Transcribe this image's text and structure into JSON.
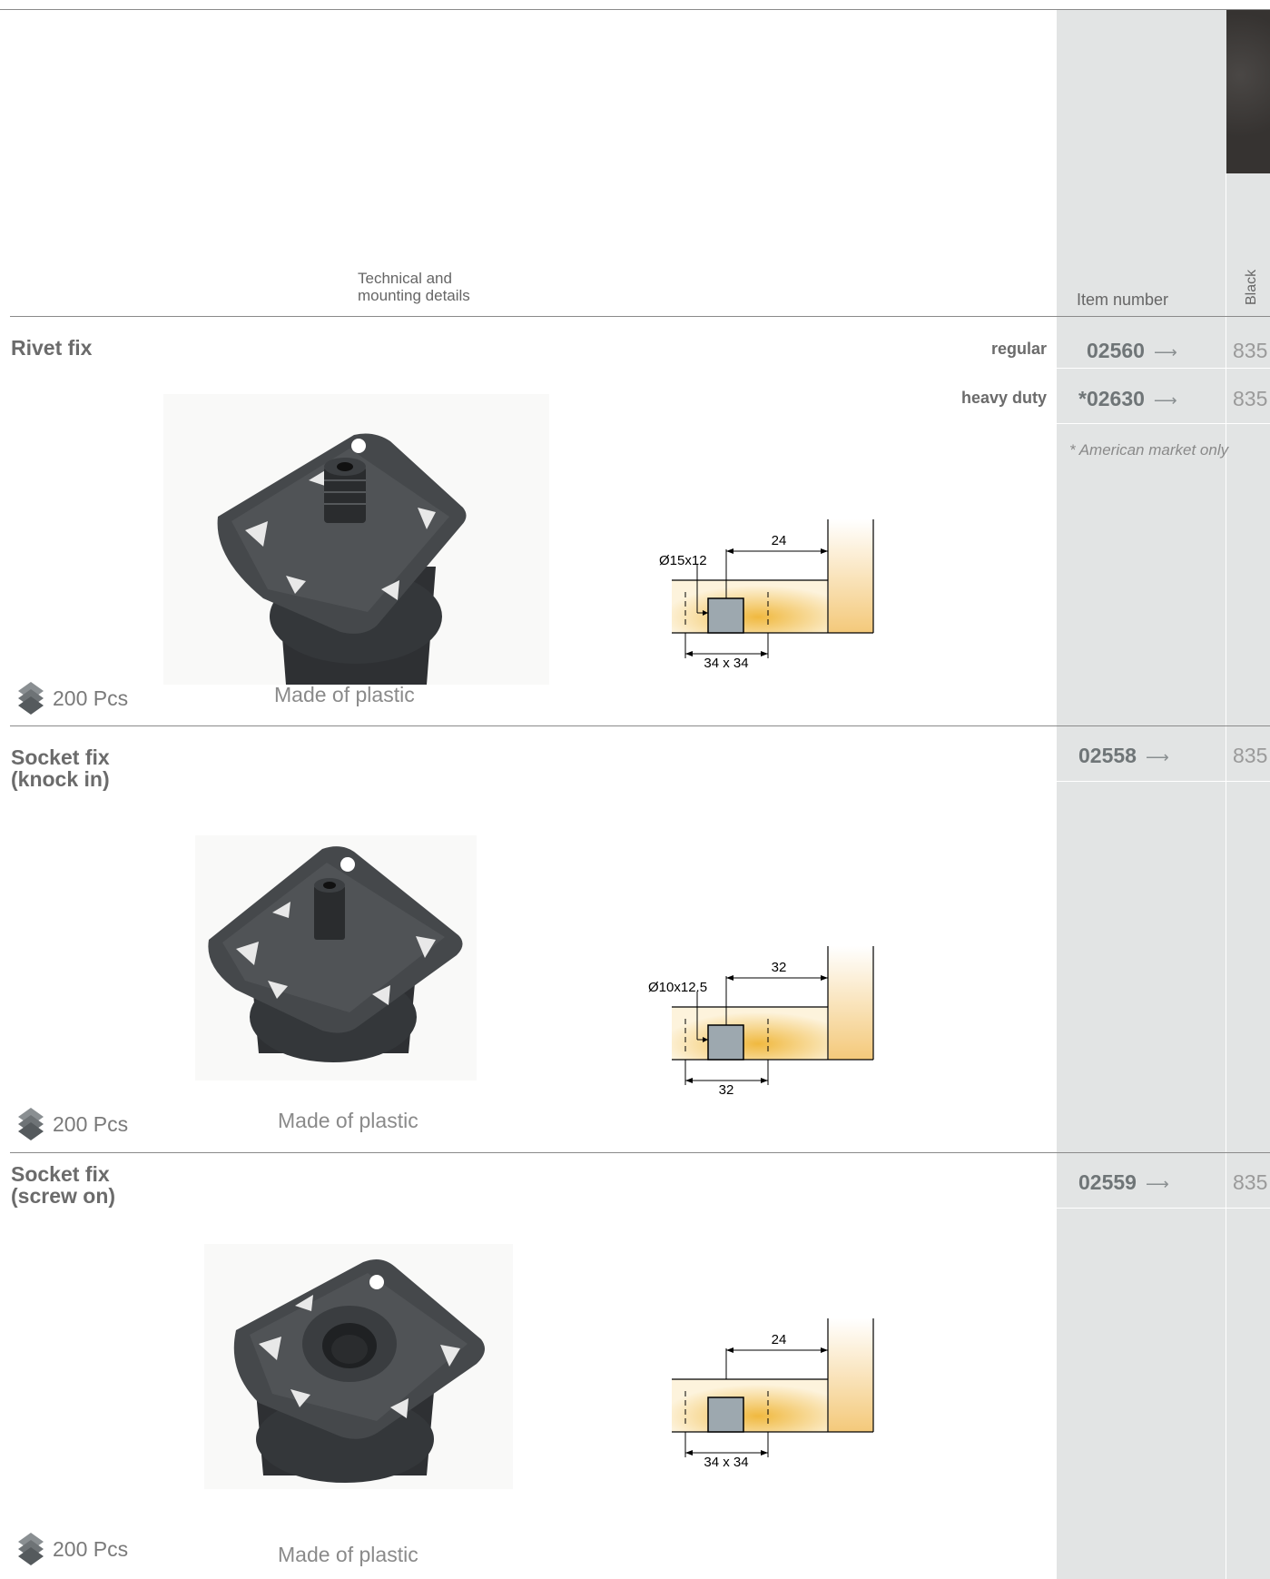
{
  "header": {
    "tech_label_line1": "Technical and",
    "tech_label_line2": "mounting details",
    "item_number_label": "Item number",
    "color_label": "Black"
  },
  "products": [
    {
      "title_line1": "Rivet fix",
      "title_line2": "",
      "variants": [
        {
          "label": "regular",
          "item_number": "02560",
          "price": "835"
        },
        {
          "label": "heavy duty",
          "item_number": "*02630",
          "price": "835"
        }
      ],
      "note": "* American market only",
      "pack": "200 Pcs",
      "material": "Made of plastic",
      "diagram": {
        "hole": "Ø15x12",
        "distance": "24",
        "bottom": "34 x 34"
      }
    },
    {
      "title_line1": "Socket fix",
      "title_line2": "(knock in)",
      "variants": [
        {
          "label": "",
          "item_number": "02558",
          "price": "835"
        }
      ],
      "pack": "200 Pcs",
      "material": "Made of plastic",
      "diagram": {
        "hole": "Ø10x12.5",
        "distance": "32",
        "bottom": "32"
      }
    },
    {
      "title_line1": "Socket fix",
      "title_line2": "(screw on)",
      "variants": [
        {
          "label": "",
          "item_number": "02559",
          "price": "835"
        }
      ],
      "pack": "200 Pcs",
      "material": "Made of plastic",
      "diagram": {
        "hole": "",
        "distance": "24",
        "bottom": "34 x 34"
      }
    }
  ],
  "arrow_glyph": "⟶",
  "icons": {
    "pack": "stack-icon",
    "arrow": "arrow-right-icon"
  },
  "colors": {
    "column_bg": "#e2e4e4",
    "swatch_black": "#3f3c3a",
    "wood": "#f0b940"
  }
}
